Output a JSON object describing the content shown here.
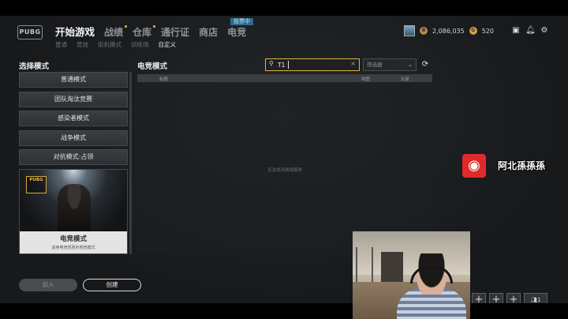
{
  "nav": {
    "logo": "PUBG",
    "items": [
      {
        "label": "开始游戏",
        "active": true,
        "dot": false
      },
      {
        "label": "战绩",
        "active": false,
        "dot": true
      },
      {
        "label": "仓库",
        "active": false,
        "dot": true
      },
      {
        "label": "通行证",
        "active": false,
        "dot": false
      },
      {
        "label": "商店",
        "active": false,
        "dot": false
      },
      {
        "label": "电竞",
        "active": false,
        "dot": false
      }
    ],
    "badge": "投票中",
    "subnav": [
      "普通",
      "竞技",
      "街机模式",
      "训练场",
      "自定义"
    ],
    "subnav_active": "自定义"
  },
  "topbar": {
    "currency_bp": "2,086,035",
    "currency_g": "520",
    "coin_bp_glyph": "B",
    "coin_g_glyph": "G",
    "icons": [
      "avatar-icon",
      "mail-icon",
      "bell-icon",
      "gear-icon"
    ]
  },
  "left": {
    "title": "选择模式",
    "modes": [
      "普通模式",
      "团队淘汰竞赛",
      "感染者模式",
      "战争模式",
      "对抗模式:占领"
    ],
    "card_title": "电竞模式",
    "card_desc": "适用电竞规则的竞技模式",
    "card_emblem": "PUBG"
  },
  "main": {
    "title": "电竞模式",
    "search_value": "T1",
    "filter_placeholder": "筛选器",
    "columns": [
      "标题",
      "地图",
      "玩家"
    ],
    "empty_text": "无法找到游戏服务"
  },
  "buttons": {
    "join": "加入",
    "create": "创建"
  },
  "overlay": {
    "streamer_name": "阿北孫孫孫",
    "squad_count": "1"
  },
  "colors": {
    "accent": "#e0b53b",
    "esports_badge": "#2c6e8f",
    "netease_red": "#e02a2a"
  }
}
